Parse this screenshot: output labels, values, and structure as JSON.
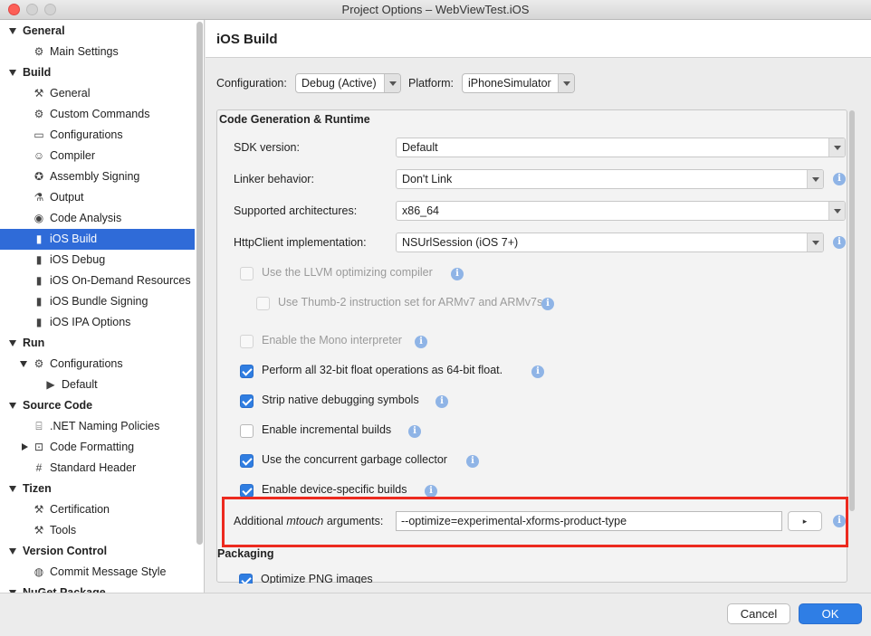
{
  "window": {
    "title": "Project Options – WebViewTest.iOS"
  },
  "sidebar": {
    "rows": [
      {
        "label": "General",
        "kind": "section",
        "arrow": "down",
        "icon": ""
      },
      {
        "label": "Main Settings",
        "kind": "item",
        "icon": "gear-icon"
      },
      {
        "label": "Build",
        "kind": "section",
        "arrow": "down",
        "icon": ""
      },
      {
        "label": "General",
        "kind": "item",
        "icon": "hammer-icon"
      },
      {
        "label": "Custom Commands",
        "kind": "item",
        "icon": "gear-icon"
      },
      {
        "label": "Configurations",
        "kind": "item",
        "icon": "window-icon"
      },
      {
        "label": "Compiler",
        "kind": "item",
        "icon": "robot-icon"
      },
      {
        "label": "Assembly Signing",
        "kind": "item",
        "icon": "badge-icon"
      },
      {
        "label": "Output",
        "kind": "item",
        "icon": "flask-icon"
      },
      {
        "label": "Code Analysis",
        "kind": "item",
        "icon": "target-icon"
      },
      {
        "label": "iOS Build",
        "kind": "item",
        "icon": "phone-icon",
        "selected": true
      },
      {
        "label": "iOS Debug",
        "kind": "item",
        "icon": "phone-icon"
      },
      {
        "label": "iOS On-Demand Resources",
        "kind": "item",
        "icon": "phone-icon"
      },
      {
        "label": "iOS Bundle Signing",
        "kind": "item",
        "icon": "phone-icon"
      },
      {
        "label": "iOS IPA Options",
        "kind": "item",
        "icon": "phone-icon"
      },
      {
        "label": "Run",
        "kind": "section",
        "arrow": "down",
        "icon": ""
      },
      {
        "label": "Configurations",
        "kind": "item",
        "icon": "gear-icon",
        "arrow": "down"
      },
      {
        "label": "Default",
        "kind": "subitem",
        "icon": "play-icon"
      },
      {
        "label": "Source Code",
        "kind": "section",
        "arrow": "down",
        "icon": ""
      },
      {
        "label": ".NET Naming Policies",
        "kind": "item",
        "icon": "ab-icon"
      },
      {
        "label": "Code Formatting",
        "kind": "item",
        "icon": "code-icon",
        "arrow": "right"
      },
      {
        "label": "Standard Header",
        "kind": "item",
        "icon": "hash-icon"
      },
      {
        "label": "Tizen",
        "kind": "section",
        "arrow": "down",
        "icon": ""
      },
      {
        "label": "Certification",
        "kind": "item",
        "icon": "hammer-icon"
      },
      {
        "label": "Tools",
        "kind": "item",
        "icon": "hammer-icon"
      },
      {
        "label": "Version Control",
        "kind": "section",
        "arrow": "down",
        "icon": ""
      },
      {
        "label": "Commit Message Style",
        "kind": "item",
        "icon": "check-circle-icon"
      },
      {
        "label": "NuGet Package",
        "kind": "section",
        "arrow": "down",
        "icon": ""
      }
    ]
  },
  "main": {
    "title": "iOS Build",
    "configuration_label": "Configuration:",
    "configuration_value": "Debug (Active)",
    "platform_label": "Platform:",
    "platform_value": "iPhoneSimulator",
    "group_title": "Code Generation & Runtime",
    "fields": {
      "sdk_label": "SDK version:",
      "sdk_value": "Default",
      "linker_label": "Linker behavior:",
      "linker_value": "Don't Link",
      "arch_label": "Supported architectures:",
      "arch_value": "x86_64",
      "httpclient_label": "HttpClient implementation:",
      "httpclient_value": "NSUrlSession (iOS 7+)"
    },
    "checkboxes": [
      {
        "label": "Use the LLVM optimizing compiler",
        "checked": false,
        "disabled": true
      },
      {
        "label": "Use Thumb-2 instruction set for ARMv7 and ARMv7s",
        "checked": false,
        "disabled": true
      },
      {
        "label": "Enable the Mono interpreter",
        "checked": false,
        "disabled": true
      },
      {
        "label": "Perform all 32-bit float operations as 64-bit float.",
        "checked": true,
        "disabled": false
      },
      {
        "label": "Strip native debugging symbols",
        "checked": true,
        "disabled": false
      },
      {
        "label": "Enable incremental builds",
        "checked": false,
        "disabled": false
      },
      {
        "label": "Use the concurrent garbage collector",
        "checked": true,
        "disabled": false
      },
      {
        "label": "Enable device-specific builds",
        "checked": true,
        "disabled": false
      }
    ],
    "mtouch_label_prefix": "Additional ",
    "mtouch_label_em": "mtouch",
    "mtouch_label_suffix": " arguments:",
    "mtouch_value": "--optimize=experimental-xforms-product-type",
    "mtouch_button": "▸",
    "packaging_title": "Packaging",
    "packaging_cut_label": "Optimize PNG images"
  },
  "footer": {
    "cancel": "Cancel",
    "ok": "OK"
  },
  "colors": {
    "accent": "#2f7ee5",
    "selection": "#2f6bd8",
    "highlight": "#ec2a1f"
  }
}
